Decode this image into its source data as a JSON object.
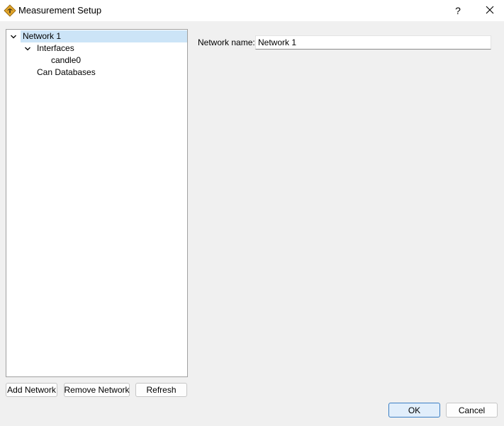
{
  "window": {
    "title": "Measurement Setup",
    "help_label": "?"
  },
  "icons": {
    "app": "app-logo-icon",
    "help": "help-icon",
    "close": "close-icon",
    "expand": "chevron-down-icon"
  },
  "tree": {
    "network": "Network 1",
    "interfaces": "Interfaces",
    "interface_item": "candle0",
    "databases": "Can Databases"
  },
  "buttons": {
    "add_network": "Add Network",
    "remove_network": "Remove Network",
    "refresh": "Refresh",
    "ok": "OK",
    "cancel": "Cancel"
  },
  "form": {
    "network_name_label": "Network name:",
    "network_name_value": "Network 1"
  },
  "colors": {
    "selection": "#cce4f7",
    "default_button_border": "#3b7fc4",
    "app_icon": "#e0a42a"
  }
}
